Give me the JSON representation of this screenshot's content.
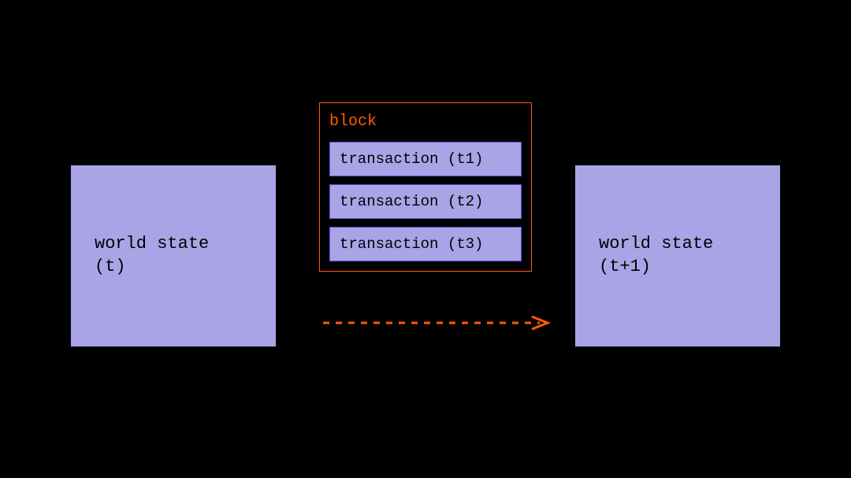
{
  "left_state": {
    "line1": "world state",
    "line2": "(t)"
  },
  "right_state": {
    "line1": "world state",
    "line2": "(t+1)"
  },
  "block": {
    "label": "block",
    "transactions": [
      "transaction (t1)",
      "transaction (t2)",
      "transaction (t3)"
    ]
  },
  "colors": {
    "accent": "#ff5c00",
    "box": "#a8a4e6",
    "border": "#5a4fcf"
  }
}
